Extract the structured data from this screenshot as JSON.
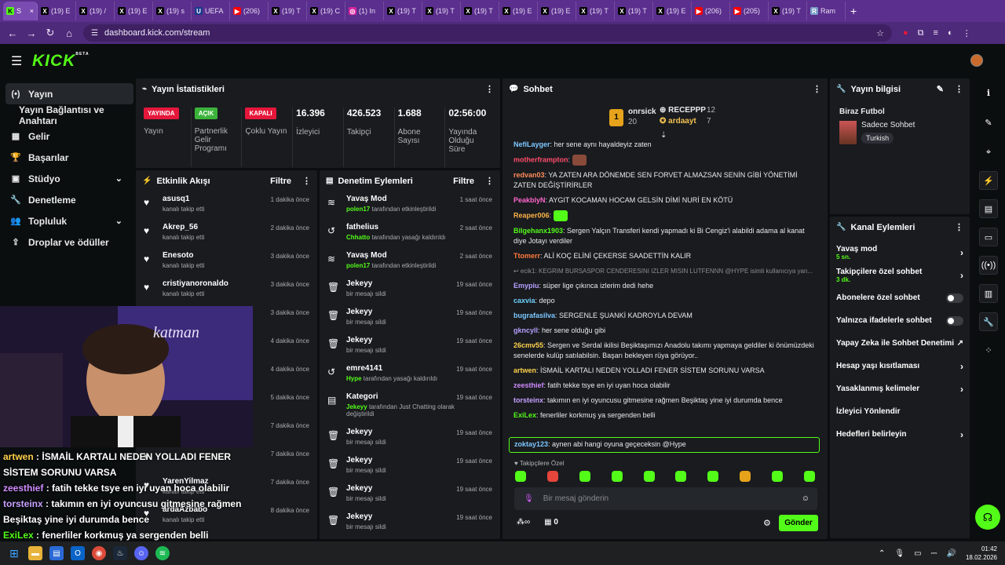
{
  "browser": {
    "tabs": [
      {
        "label": "S",
        "fav": "K",
        "color": "#53fc18",
        "active": true
      },
      {
        "label": "(19) E",
        "fav": "X",
        "color": "#000000"
      },
      {
        "label": "(19) /",
        "fav": "X",
        "color": "#000000"
      },
      {
        "label": "(19) E",
        "fav": "X",
        "color": "#000000"
      },
      {
        "label": "(19) s",
        "fav": "X",
        "color": "#000000"
      },
      {
        "label": "UEFA",
        "fav": "U",
        "color": "#1a3a8c"
      },
      {
        "label": "(206)",
        "fav": "▶",
        "color": "#ff0000"
      },
      {
        "label": "(19) T",
        "fav": "X",
        "color": "#000000"
      },
      {
        "label": "(19) C",
        "fav": "X",
        "color": "#000000"
      },
      {
        "label": "(1) In",
        "fav": "◎",
        "color": "#d6249f"
      },
      {
        "label": "(19) T",
        "fav": "X",
        "color": "#000000"
      },
      {
        "label": "(19) T",
        "fav": "X",
        "color": "#000000"
      },
      {
        "label": "(19) T",
        "fav": "X",
        "color": "#000000"
      },
      {
        "label": "(19) E",
        "fav": "X",
        "color": "#000000"
      },
      {
        "label": "(19) E",
        "fav": "X",
        "color": "#000000"
      },
      {
        "label": "(19) T",
        "fav": "X",
        "color": "#000000"
      },
      {
        "label": "(19) T",
        "fav": "X",
        "color": "#000000"
      },
      {
        "label": "(19) E",
        "fav": "X",
        "color": "#000000"
      },
      {
        "label": "(206)",
        "fav": "▶",
        "color": "#ff0000"
      },
      {
        "label": "(205)",
        "fav": "▶",
        "color": "#ff0000"
      },
      {
        "label": "(19) T",
        "fav": "X",
        "color": "#000000"
      },
      {
        "label": "Ram",
        "fav": "R",
        "color": "#7a9cc6"
      }
    ],
    "url": "dashboard.kick.com/stream"
  },
  "sidebar": {
    "items": [
      {
        "icon": "(•)",
        "label": "Yayın",
        "active": true
      },
      {
        "icon": "",
        "label": "Yayın Bağlantısı ve Anahtarı",
        "sub": true
      },
      {
        "icon": "▦",
        "label": "Gelir"
      },
      {
        "icon": "🏆",
        "label": "Başarılar"
      },
      {
        "icon": "▣",
        "label": "Stüdyo",
        "chev": true
      },
      {
        "icon": "🔧",
        "label": "Denetleme"
      },
      {
        "icon": "👥",
        "label": "Topluluk",
        "chev": true
      },
      {
        "icon": "⇪",
        "label": "Droplar ve ödüller"
      }
    ]
  },
  "stats": {
    "title": "Yayın İstatistikleri",
    "cells": [
      {
        "badge": "YAYINDA",
        "badge_color": "#e5173b",
        "label": "Yayın"
      },
      {
        "badge": "AÇIK",
        "badge_color": "#3bb33b",
        "label": "Partnerlik Gelir Programı"
      },
      {
        "badge": "KAPALI",
        "badge_color": "#e5173b",
        "label": "Çoklu Yayın"
      },
      {
        "num": "16.396",
        "label": "İzleyici"
      },
      {
        "num": "426.523",
        "label": "Takipçi"
      },
      {
        "num": "1.688",
        "label": "Abone Sayısı"
      },
      {
        "num": "02:56:00",
        "label": "Yayında Olduğu Süre"
      }
    ]
  },
  "activity": {
    "title": "Etkinlik Akışı",
    "filter": "Filtre",
    "rows": [
      {
        "name": "asusq1",
        "sub": "kanalı takip etti",
        "time": "1 dakika önce"
      },
      {
        "name": "Akrep_56",
        "sub": "kanalı takip etti",
        "time": "2 dakika önce"
      },
      {
        "name": "Enesoto",
        "sub": "kanalı takip etti",
        "time": "3 dakika önce"
      },
      {
        "name": "cristiyanoronaldo",
        "sub": "kanalı takip etti",
        "time": "3 dakika önce"
      },
      {
        "name": "",
        "sub": "",
        "time": "3 dakika önce"
      },
      {
        "name": "",
        "sub": "",
        "time": "4 dakika önce"
      },
      {
        "name": "",
        "sub": "",
        "time": "4 dakika önce"
      },
      {
        "name": "",
        "sub": "",
        "time": "5 dakika önce"
      },
      {
        "name": "",
        "sub": "",
        "time": "7 dakika önce"
      },
      {
        "name": "",
        "sub": "",
        "time": "7 dakika önce"
      },
      {
        "name": "YarenYilmaz",
        "sub": "kanalı takip etti",
        "time": "7 dakika önce"
      },
      {
        "name": "ardaAzbabo",
        "sub": "kanalı takip etti",
        "time": "8 dakika önce"
      }
    ]
  },
  "moderation": {
    "title": "Denetim Eylemleri",
    "filter": "Filtre",
    "rows": [
      {
        "icon": "≋",
        "name": "Yavaş Mod",
        "by": "polen17",
        "rest": "tarafından etkinleştirildi",
        "time": "1 saat önce"
      },
      {
        "icon": "↺",
        "name": "fathelius",
        "by": "Chhatto",
        "rest": "tarafından yasağı kaldırıldı",
        "time": "2 saat önce"
      },
      {
        "icon": "≋",
        "name": "Yavaş Mod",
        "by": "polen17",
        "rest": "tarafından etkinleştirildi",
        "time": "2 saat önce"
      },
      {
        "icon": "🗑",
        "name": "Jekeyy",
        "by": "",
        "rest": "bir mesajı sildi",
        "time": "19 saat önce"
      },
      {
        "icon": "🗑",
        "name": "Jekeyy",
        "by": "",
        "rest": "bir mesajı sildi",
        "time": "19 saat önce"
      },
      {
        "icon": "🗑",
        "name": "Jekeyy",
        "by": "",
        "rest": "bir mesajı sildi",
        "time": "19 saat önce"
      },
      {
        "icon": "↺",
        "name": "emre4141",
        "by": "Hype",
        "rest": "tarafından yasağı kaldırıldı",
        "time": "19 saat önce"
      },
      {
        "icon": "▤",
        "name": "Kategori",
        "by": "Jekeyy",
        "rest": "tarafından Just Chatting olarak değiştirildi",
        "time": "19 saat önce",
        "tall": true
      },
      {
        "icon": "🗑",
        "name": "Jekeyy",
        "by": "",
        "rest": "bir mesajı sildi",
        "time": "19 saat önce"
      },
      {
        "icon": "🗑",
        "name": "Jekeyy",
        "by": "",
        "rest": "bir mesajı sildi",
        "time": "19 saat önce"
      },
      {
        "icon": "🗑",
        "name": "Jekeyy",
        "by": "",
        "rest": "bir mesajı sildi",
        "time": "19 saat önce"
      },
      {
        "icon": "🗑",
        "name": "Jekeyy",
        "by": "",
        "rest": "bir mesajı sildi",
        "time": "19 saat önce"
      }
    ]
  },
  "chat": {
    "title": "Sohbet",
    "leaders": [
      {
        "rank": "1",
        "name": "onrsick",
        "count": "20"
      },
      {
        "name": "RECEPPP",
        "count": "12"
      },
      {
        "name": "ardaayt",
        "count": "7"
      }
    ],
    "messages": [
      {
        "user": "NefiLayger",
        "color": "#7ec8ff",
        "text": "her sene aynı hayaldeyiz zaten"
      },
      {
        "user": "motherframpton",
        "color": "#ff4c6a",
        "text": "",
        "emote": true
      },
      {
        "user": "redvan03",
        "color": "#ff8c5a",
        "text": "YA ZATEN ARA DÖNEMDE SEN FORVET ALMAZSAN SENİN GİBİ YÖNETİMİ ZATEN DEĞİŞTİRİRLER"
      },
      {
        "user": "PeakblyN",
        "color": "#ff66cc",
        "text": "AYGIT KOCAMAN HOCAM GELSİN DİMİ NURİ EN KÖTÜ"
      },
      {
        "user": "Reaper006",
        "color": "#ffb347",
        "text": "",
        "emote": true
      },
      {
        "user": "Bilgehanx1903",
        "color": "#53fc18",
        "text": "Sergen Yalçın Transferi kendi yapmadı ki Bi Cengiz'i alabildi adama al kanat diye Jotayı verdiler"
      },
      {
        "user": "Ttomerr",
        "color": "#ff7a3c",
        "text": "ALİ KOÇ ELİNİ ÇEKERSE SAADETTİN KALIR"
      },
      {
        "user": "",
        "color": "#8a8d92",
        "text": "↩ ecik1: KEGRIM BURSASPOR CENDERESINI IZLER MISIN LUTFENNN @HYPE isimli kullanıcıya yan...",
        "reply": true
      },
      {
        "user": "Emypiu",
        "color": "#b8a0ff",
        "text": "süper lige çıkınca izlerim dedi hehe"
      },
      {
        "user": "caxvia",
        "color": "#6fd3ff",
        "text": "depo"
      },
      {
        "user": "bugrafasilva",
        "color": "#7ec8ff",
        "text": "SERGENLE ŞUANKİ KADROYLA DEVAM"
      },
      {
        "user": "gkncyll",
        "color": "#b8a0ff",
        "text": "her sene olduğu gibi"
      },
      {
        "user": "26cmv55",
        "color": "#ffd24c",
        "text": "Sergen ve Serdal ikilisi Beşiktaşımızı Anadolu takımı yapmaya geldiler ki önümüzdeki senelerde kulüp satılabilsin. Başarı bekleyen rüya görüyor.."
      },
      {
        "user": "artwen",
        "color": "#ffd24c",
        "text": "İSMAİL KARTALI NEDEN YOLLADI FENER SİSTEM SORUNU VARSA"
      },
      {
        "user": "zeesthief",
        "color": "#d08cff",
        "text": "fatih tekke tsye en iyi uyan hoca olabilir"
      },
      {
        "user": "torsteinx",
        "color": "#c8a0ff",
        "text": "takımın en iyi oyuncusu gitmesine rağmen Beşiktaş yine iyi durumda bence"
      },
      {
        "user": "ExiLex",
        "color": "#53fc18",
        "text": "fenerliler korkmuş ya sergenden belli"
      }
    ],
    "pinned": {
      "user": "zoktay123",
      "text": "aynen abi hangi oyuna geçeceksin @Hype"
    },
    "mode": "Takipçilere Özel",
    "placeholder": "Bir mesaj gönderin",
    "points": "0",
    "send": "Gönder"
  },
  "stream_info": {
    "title": "Yayın bilgisi",
    "stream_title": "Biraz Futbol",
    "category": "Sadece Sohbet",
    "tag": "Turkish"
  },
  "channel_actions": {
    "title": "Kanal Eylemleri",
    "items": [
      {
        "label": "Yavaş mod",
        "sub": "5 sn.",
        "type": "chev"
      },
      {
        "label": "Takipçilere özel sohbet",
        "sub": "3 dk.",
        "type": "chev"
      },
      {
        "label": "Abonelere özel sohbet",
        "type": "toggle"
      },
      {
        "label": "Yalnızca ifadelerle sohbet",
        "type": "toggle"
      },
      {
        "label": "Yapay Zeka ile Sohbet Denetimi",
        "type": "ext"
      },
      {
        "label": "Hesap yaşı kısıtlaması",
        "type": "chev"
      },
      {
        "label": "Yasaklanmış kelimeler",
        "type": "chev"
      },
      {
        "label": "İzleyici Yönlendir",
        "type": "none"
      },
      {
        "label": "Hedefleri belirleyin",
        "type": "chev"
      }
    ]
  },
  "overlay": {
    "lines": [
      {
        "user": "artwen",
        "color": "#ffd24c",
        "text": "İSMAİL KARTALI NEDEN YOLLADI FENER SİSTEM SORUNU VARSA"
      },
      {
        "user": "zeesthief",
        "color": "#d08cff",
        "text": "fatih tekke tsye en iyi uyan hoca olabilir"
      },
      {
        "user": "torsteinx",
        "color": "#c8a0ff",
        "text": "takımın en iyi oyuncusu gitmesine rağmen Beşiktaş yine iyi durumda bence"
      },
      {
        "user": "ExiLex",
        "color": "#53fc18",
        "text": "fenerliler korkmuş ya sergenden belli"
      }
    ]
  },
  "taskbar": {
    "time": "01:42",
    "date": "18.02.2026"
  }
}
